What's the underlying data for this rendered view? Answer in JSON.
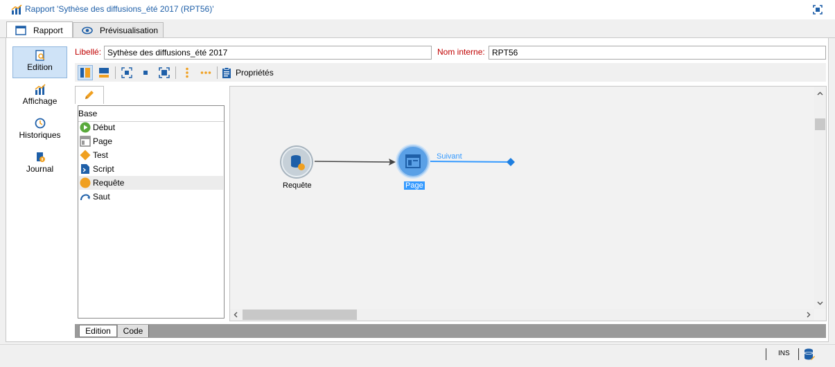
{
  "window": {
    "title": "Rapport 'Sythèse des diffusions_été 2017 (RPT56)'"
  },
  "tabs": [
    {
      "label": "Rapport",
      "icon": "window-icon"
    },
    {
      "label": "Prévisualisation",
      "icon": "eye-icon"
    }
  ],
  "nav": [
    {
      "label": "Edition",
      "icon": "edit-report-icon",
      "active": true
    },
    {
      "label": "Affichage",
      "icon": "chart-icon"
    },
    {
      "label": "Historiques",
      "icon": "clock-icon"
    },
    {
      "label": "Journal",
      "icon": "journal-icon"
    }
  ],
  "fields": {
    "libelle_label": "Libellé:",
    "libelle_value": "Sythèse des diffusions_été 2017",
    "nom_interne_label": "Nom interne:",
    "nom_interne_value": "RPT56"
  },
  "toolbar": {
    "properties_label": "Propriétés"
  },
  "palette": {
    "group": "Base",
    "items": [
      {
        "label": "Début",
        "icon": "start-icon"
      },
      {
        "label": "Page",
        "icon": "page-icon"
      },
      {
        "label": "Test",
        "icon": "test-diamond-icon"
      },
      {
        "label": "Script",
        "icon": "script-icon"
      },
      {
        "label": "Requête",
        "icon": "query-icon"
      },
      {
        "label": "Saut",
        "icon": "jump-icon"
      }
    ]
  },
  "canvas": {
    "nodes": [
      {
        "label": "Requête"
      },
      {
        "label": "Page"
      }
    ],
    "transition_label": "Suivant"
  },
  "bottom_tabs": [
    {
      "label": "Edition"
    },
    {
      "label": "Code"
    }
  ],
  "status": {
    "mode": "INS"
  },
  "colors": {
    "accent": "#1e5fa8",
    "required_label": "#c00000",
    "selection": "#3399ff"
  }
}
